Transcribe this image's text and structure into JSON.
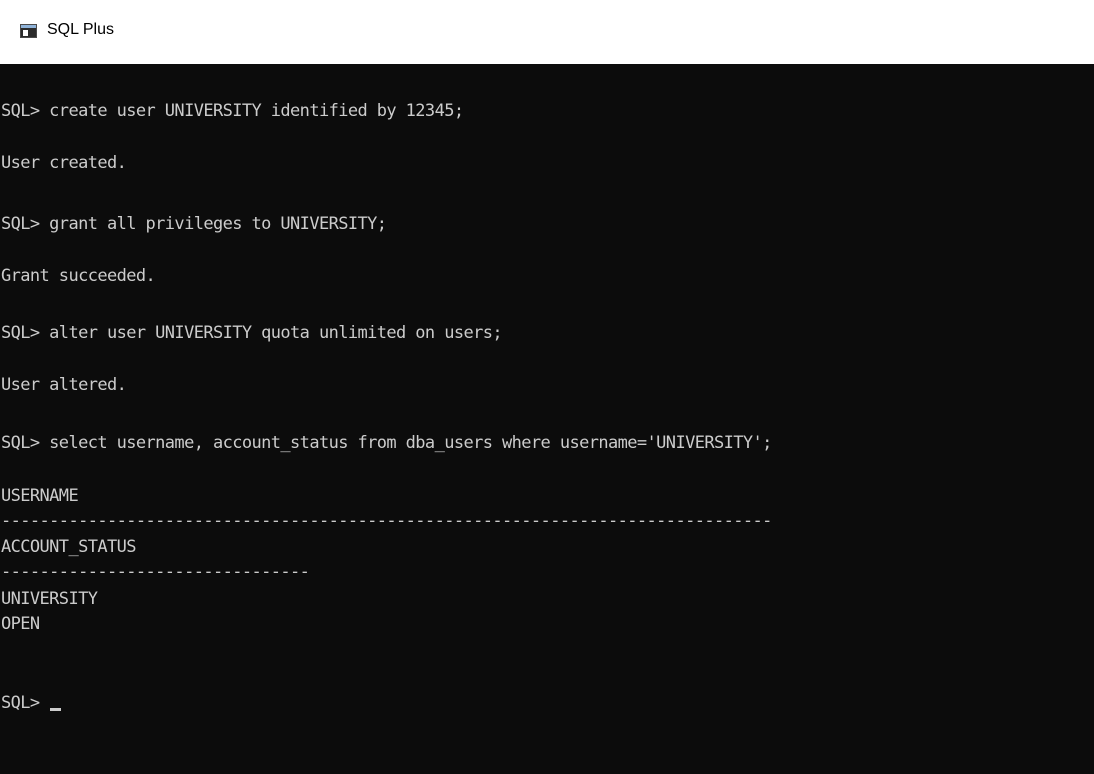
{
  "window": {
    "title": "SQL Plus",
    "icon": "console-window-icon"
  },
  "console": {
    "lines": [
      "SQL> create user UNIVERSITY identified by 12345;",
      "User created.",
      "SQL> grant all privileges to UNIVERSITY;",
      "Grant succeeded.",
      "SQL> alter user UNIVERSITY quota unlimited on users;",
      "User altered.",
      "SQL> select username, account_status from dba_users where username='UNIVERSITY';",
      "USERNAME",
      "--------------------------------------------------------------------------------",
      "ACCOUNT_STATUS",
      "--------------------------------",
      "UNIVERSITY",
      "OPEN",
      "SQL> "
    ]
  },
  "colors": {
    "background": "#0c0c0c",
    "text": "#cccccc",
    "titlebar": "#ffffff"
  }
}
